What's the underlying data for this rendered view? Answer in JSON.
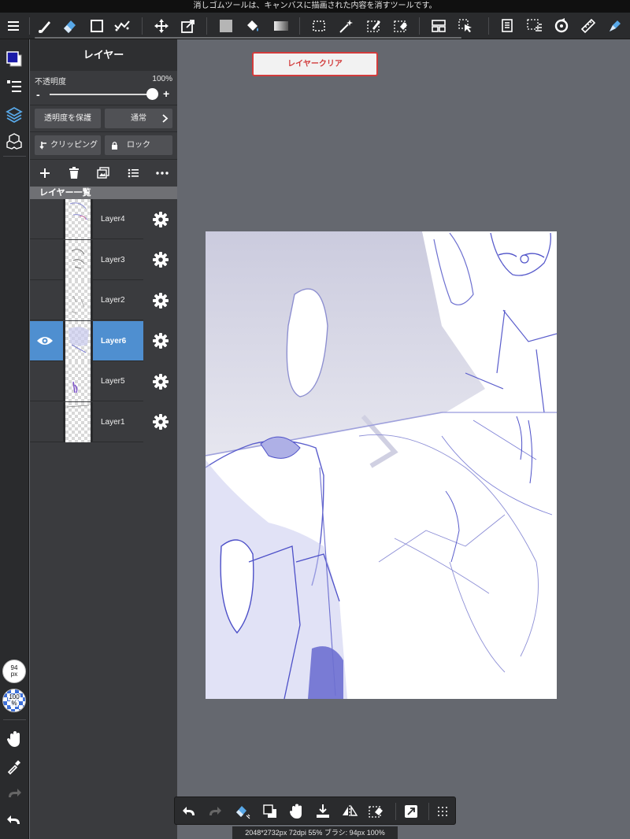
{
  "status_bar": {
    "message": "消しゴムツールは、キャンバスに描画された内容を消すツールです。"
  },
  "top_toolbar": {
    "tools": [
      "menu-icon",
      "brush-icon",
      "eraser-icon",
      "rectangle-icon",
      "dot-brush-icon",
      "move-icon",
      "transform-icon",
      "fill-color-icon",
      "bucket-icon",
      "gradient-icon",
      "select-icon",
      "magic-wand-icon",
      "select-pen-icon",
      "select-eraser-icon",
      "layout-icon",
      "select-move-icon",
      "material-icon",
      "select-all-icon",
      "rotate-icon",
      "ruler-icon",
      "pen-settings-icon"
    ],
    "active_tool": "eraser-icon"
  },
  "colors": {
    "accent": "#4f8fd0",
    "primary_color": "#1a1aa8",
    "clear_button_border": "#d23c3c"
  },
  "brush": {
    "size_value": "94",
    "size_unit": "px",
    "opacity_value": "100",
    "opacity_unit": "%"
  },
  "layer_panel": {
    "title": "レイヤー",
    "opacity_label": "不透明度",
    "opacity_value": "100%",
    "opacity_fraction": 1.0,
    "slider_minus": "-",
    "slider_plus": "+",
    "protect_alpha_label": "透明度を保護",
    "blend_mode_label": "通常",
    "clipping_label": "クリッピング",
    "lock_label": "ロック",
    "list_header": "レイヤー一覧",
    "layers": [
      {
        "name": "Layer4",
        "visible": false,
        "selected": false
      },
      {
        "name": "Layer3",
        "visible": false,
        "selected": false
      },
      {
        "name": "Layer2",
        "visible": false,
        "selected": false
      },
      {
        "name": "Layer6",
        "visible": true,
        "selected": true
      },
      {
        "name": "Layer5",
        "visible": false,
        "selected": false
      },
      {
        "name": "Layer1",
        "visible": false,
        "selected": false
      }
    ]
  },
  "canvas": {
    "clear_layer_label": "レイヤークリア",
    "info": "2048*2732px 72dpi 55% ブラシ: 94px 100%"
  }
}
